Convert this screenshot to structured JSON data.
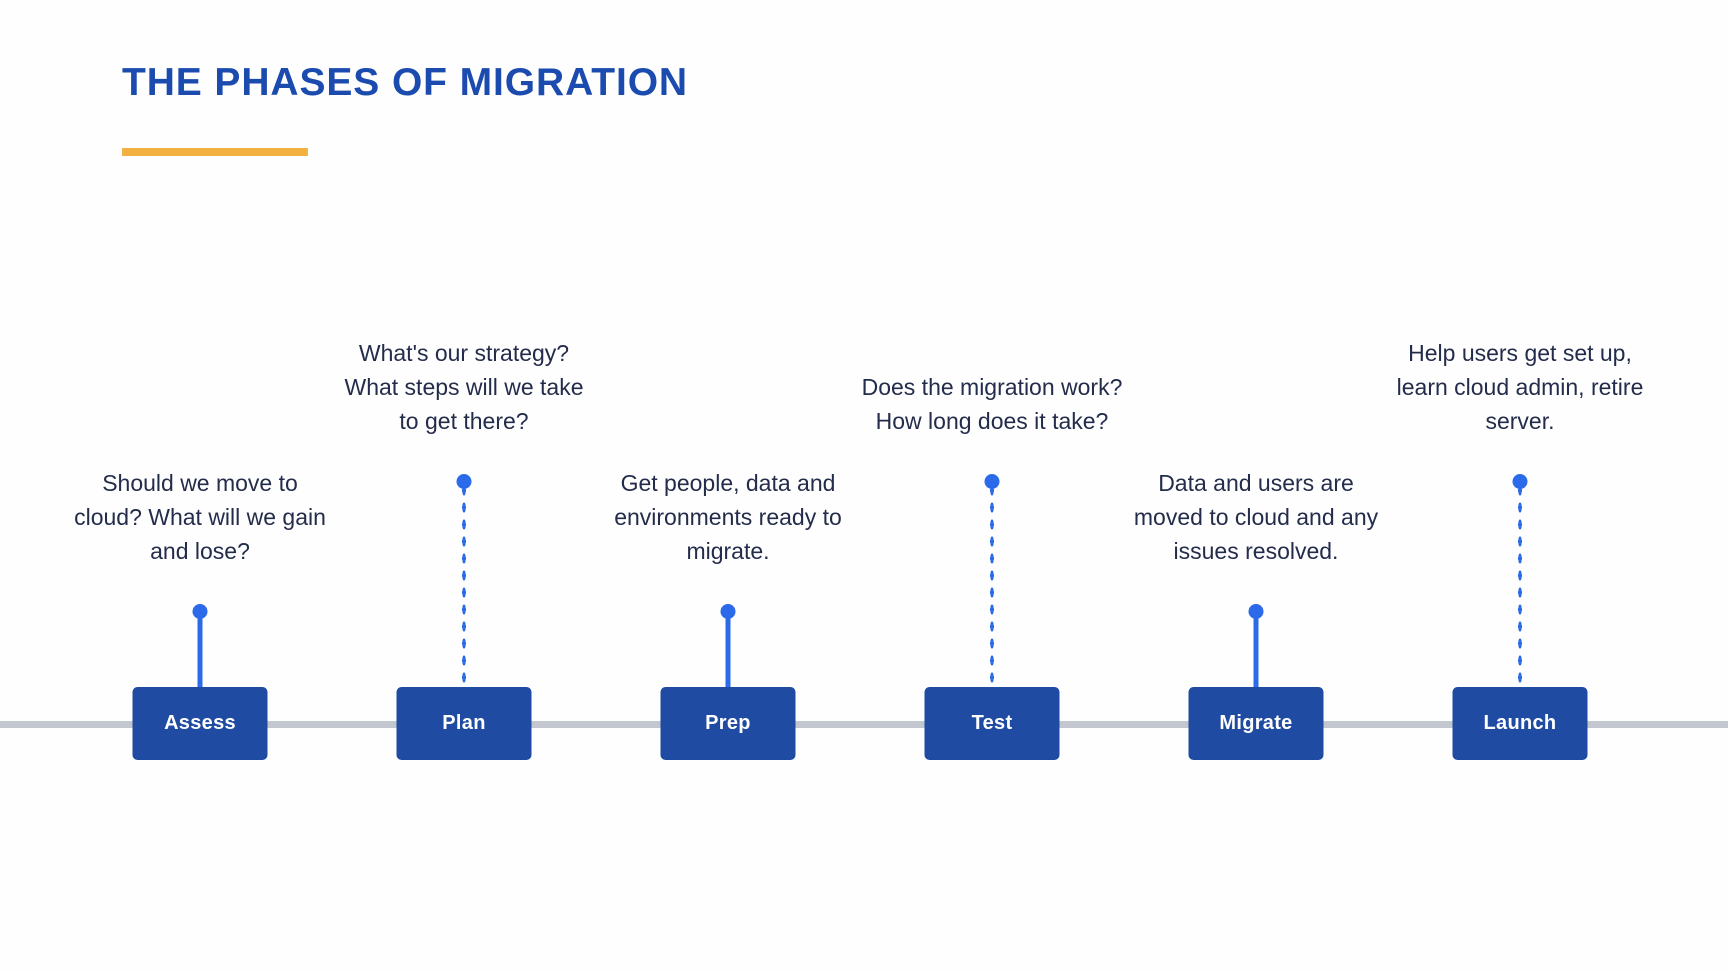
{
  "header": {
    "title": "THE PHASES OF MIGRATION",
    "accent_color": "#f0b141",
    "title_color": "#1c4bb0"
  },
  "theme": {
    "box_color": "#1f4ba3",
    "connector_color": "#2b6ae8",
    "timeline_color": "#c3c7cf",
    "body_text_color": "#242c4b"
  },
  "timeline": {
    "phases": [
      {
        "label": "Assess",
        "description": "Should we move to cloud? What will we gain and lose?",
        "connector_style": "solid",
        "text_position": "low"
      },
      {
        "label": "Plan",
        "description": "What's our strategy? What steps will we take to get there?",
        "connector_style": "dotted",
        "text_position": "high"
      },
      {
        "label": "Prep",
        "description": "Get people, data and environments ready to migrate.",
        "connector_style": "solid",
        "text_position": "low"
      },
      {
        "label": "Test",
        "description": "Does the migration work? How long does it take?",
        "connector_style": "dotted",
        "text_position": "high"
      },
      {
        "label": "Migrate",
        "description": "Data and users are moved to cloud and any issues resolved.",
        "connector_style": "solid",
        "text_position": "low"
      },
      {
        "label": "Launch",
        "description": "Help users get set up, learn cloud admin, retire server.",
        "connector_style": "dotted",
        "text_position": "high"
      }
    ]
  }
}
